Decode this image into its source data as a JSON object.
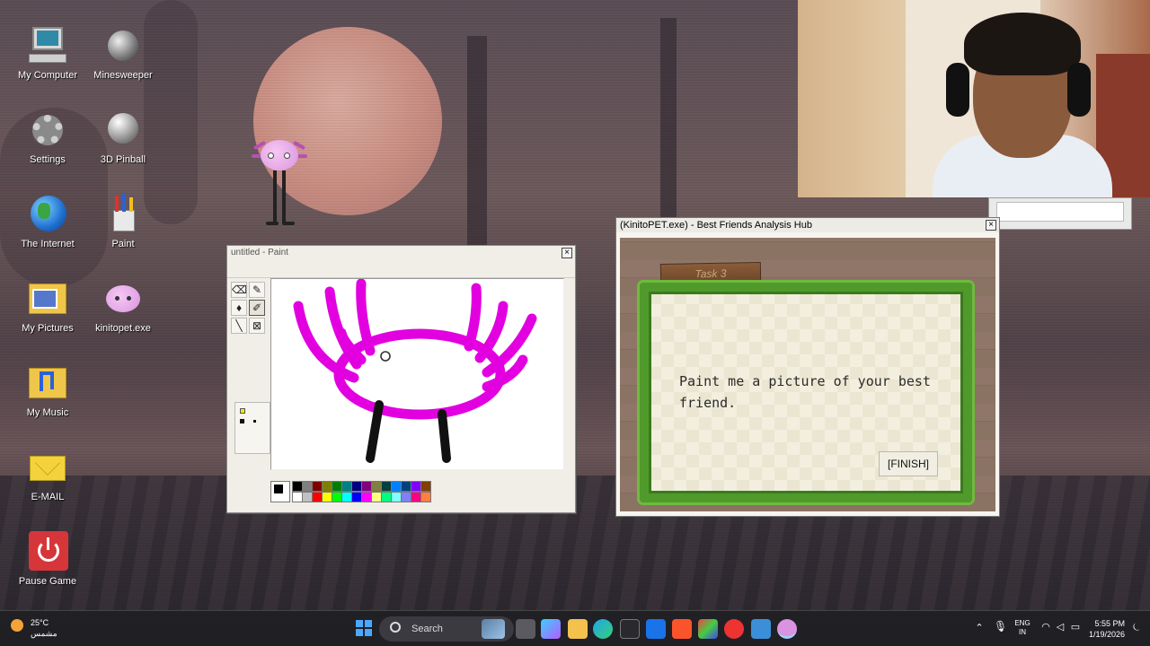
{
  "desktop": {
    "icons": [
      {
        "label": "My Computer",
        "icon": "computer-icon"
      },
      {
        "label": "Minesweeper",
        "icon": "mine-icon"
      },
      {
        "label": "Settings",
        "icon": "gear-icon"
      },
      {
        "label": "3D Pinball",
        "icon": "pinball-icon"
      },
      {
        "label": "The Internet",
        "icon": "globe-icon"
      },
      {
        "label": "Paint",
        "icon": "paint-icon"
      },
      {
        "label": "My Pictures",
        "icon": "pictures-folder-icon"
      },
      {
        "label": "kinitopet.exe",
        "icon": "kinito-icon"
      },
      {
        "label": "My Music",
        "icon": "music-folder-icon"
      },
      {
        "label": "E-MAIL",
        "icon": "mail-icon"
      },
      {
        "label": "Pause Game",
        "icon": "power-icon"
      }
    ]
  },
  "paint": {
    "title": "untitled - Paint",
    "close": "×",
    "palette_colors": [
      "#000000",
      "#808080",
      "#800000",
      "#808000",
      "#008000",
      "#008080",
      "#000080",
      "#800080",
      "#808040",
      "#004040",
      "#0080ff",
      "#004080",
      "#8000ff",
      "#804000",
      "#ffffff",
      "#c0c0c0",
      "#ff0000",
      "#ffff00",
      "#00ff00",
      "#00ffff",
      "#0000ff",
      "#ff00ff",
      "#ffff80",
      "#00ff80",
      "#80ffff",
      "#8080ff",
      "#ff0080",
      "#ff8040"
    ]
  },
  "kinito": {
    "title": "(KinitoPET.exe) - Best Friends Analysis Hub",
    "close": "×",
    "task_label": "Task 3",
    "message": "Paint me a picture of your best friend.",
    "finish_label": "[FINISH]"
  },
  "taskbar": {
    "weather_temp": "25°C",
    "weather_desc": "مشمس",
    "search_label": "Search",
    "lang_top": "ENG",
    "lang_bottom": "IN",
    "time": "5:55 PM",
    "date": "1/19/2026"
  }
}
